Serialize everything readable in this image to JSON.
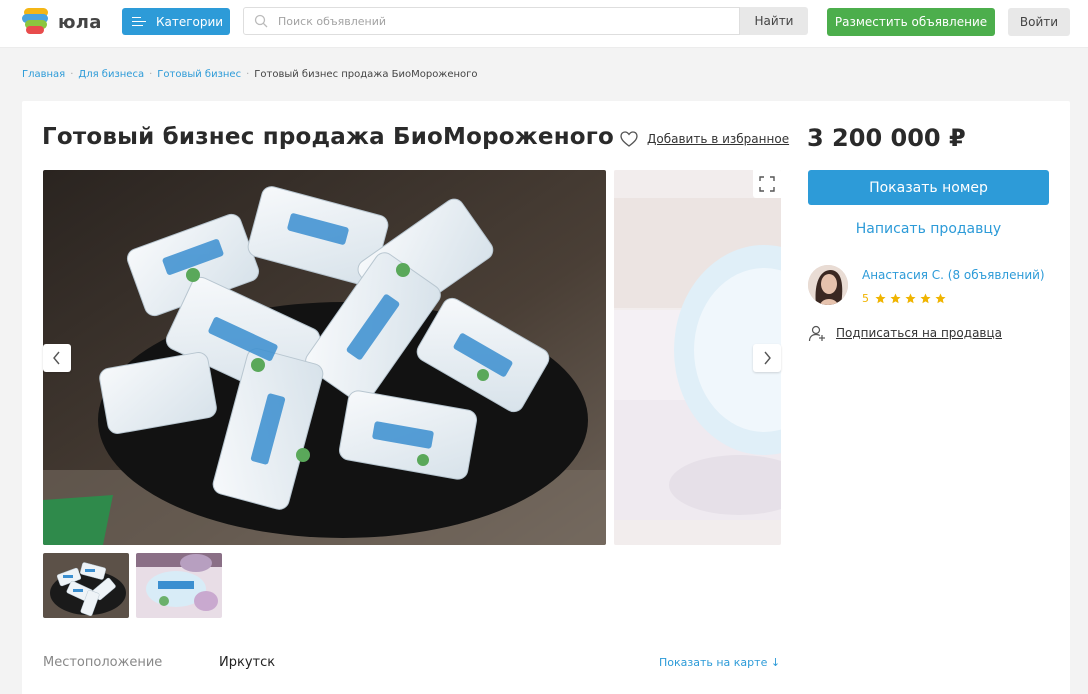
{
  "header": {
    "logo_text": "юла",
    "categories_label": "Категории",
    "search_placeholder": "Поиск объявлений",
    "find_label": "Найти",
    "post_label": "Разместить объявление",
    "login_label": "Войти"
  },
  "breadcrumb": [
    "Главная",
    "Для бизнеса",
    "Готовый бизнес",
    "Готовый бизнес продажа БиоМороженого"
  ],
  "listing": {
    "title": "Готовый бизнес продажа БиоМороженого",
    "favorite_label": "Добавить в избранное",
    "price": "3 200 000 ₽",
    "location_label": "Местоположение",
    "location_value": "Иркутск",
    "map_link": "Показать на карте ↓"
  },
  "seller": {
    "show_phone_label": "Показать номер",
    "write_label": "Написать продавцу",
    "name": "Анастасия С. (8 объявлений)",
    "rating": "5",
    "stars": 5,
    "subscribe_label": "Подписаться на продавца"
  },
  "icons": {
    "logo": "yula-logo-icon",
    "categories": "menu-icon",
    "search": "search-icon",
    "favorite": "heart-icon",
    "expand": "expand-icon",
    "prev": "chevron-left-icon",
    "next": "chevron-right-icon",
    "star": "star-icon",
    "subscribe": "subscribe-icon"
  },
  "colors": {
    "accent": "#2d9bd8",
    "post_button": "#4cae4c",
    "star": "#f0b400"
  }
}
